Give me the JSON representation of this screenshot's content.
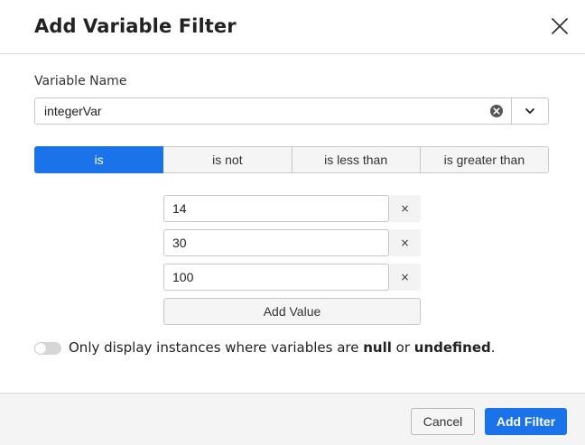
{
  "dialog": {
    "title": "Add Variable Filter",
    "close_icon": "close-icon"
  },
  "variable": {
    "label": "Variable Name",
    "value": "integerVar",
    "clear_icon": "clear-circle-icon",
    "dropdown_icon": "chevron-down-icon"
  },
  "operators": {
    "items": [
      {
        "label": "is",
        "active": true
      },
      {
        "label": "is not",
        "active": false
      },
      {
        "label": "is less than",
        "active": false
      },
      {
        "label": "is greater than",
        "active": false
      }
    ]
  },
  "values": {
    "items": [
      "14",
      "30",
      "100"
    ],
    "remove_label": "×",
    "add_label": "Add Value"
  },
  "toggle": {
    "on": false,
    "text_before": "Only display instances where variables are ",
    "strong_1": "null",
    "text_middle": " or ",
    "strong_2": "undefined",
    "text_after": "."
  },
  "footer": {
    "cancel_label": "Cancel",
    "submit_label": "Add Filter"
  },
  "colors": {
    "accent": "#1a73e8",
    "border": "#c8c8c8",
    "footer_bg": "#f4f4f4"
  }
}
